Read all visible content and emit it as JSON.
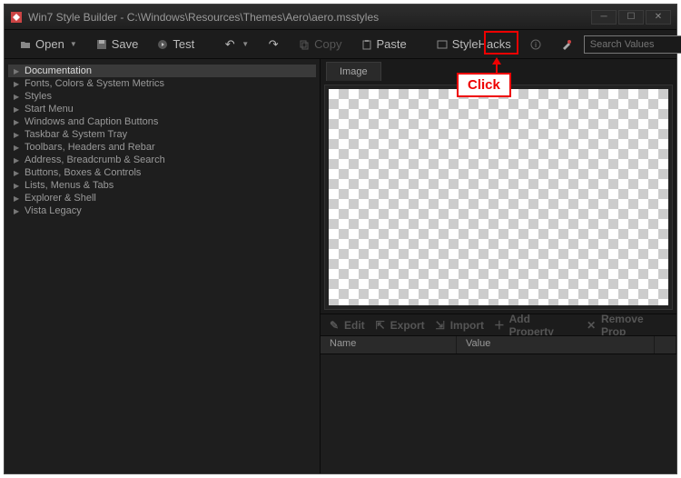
{
  "title": "Win7 Style Builder - C:\\Windows\\Resources\\Themes\\Aero\\aero.msstyles",
  "toolbar": {
    "open": "Open",
    "save": "Save",
    "test": "Test",
    "copy": "Copy",
    "paste": "Paste",
    "stylehacks": "StyleHacks"
  },
  "search": {
    "placeholder": "Search Values"
  },
  "tree": [
    "Documentation",
    "Fonts, Colors & System Metrics",
    "Styles",
    "Start Menu",
    "Windows and Caption Buttons",
    "Taskbar & System Tray",
    "Toolbars, Headers and Rebar",
    "Address, Breadcrumb & Search",
    "Buttons, Boxes & Controls",
    "Lists, Menus & Tabs",
    "Explorer & Shell",
    "Vista Legacy"
  ],
  "tree_selected": 0,
  "tab": {
    "image": "Image"
  },
  "prop_toolbar": {
    "edit": "Edit",
    "export": "Export",
    "import": "Import",
    "add": "Add Property",
    "remove": "Remove Prop"
  },
  "prop_cols": {
    "name": "Name",
    "value": "Value"
  },
  "annotation": {
    "label": "Click"
  }
}
